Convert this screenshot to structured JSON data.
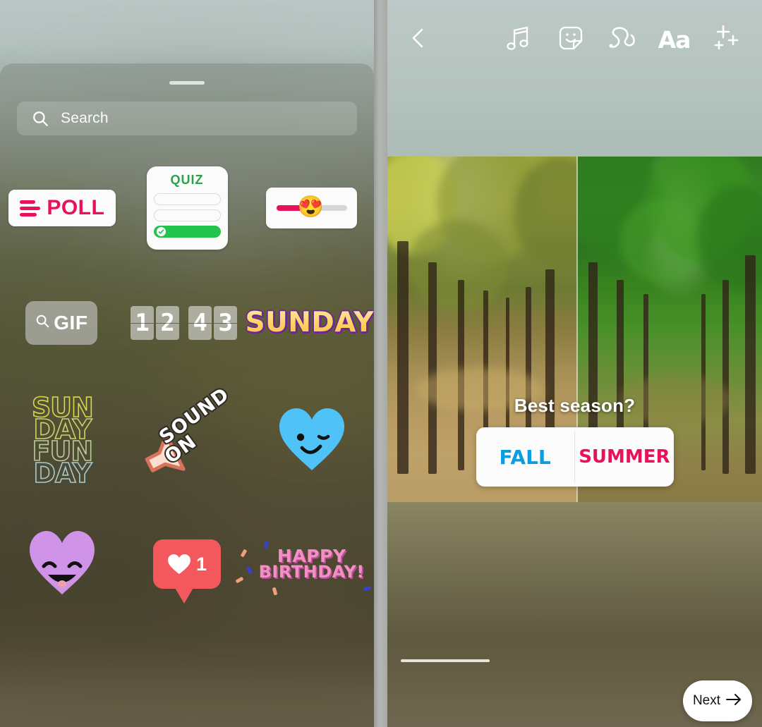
{
  "left_panel": {
    "name": "sticker-tray",
    "grabber": "drag-handle",
    "search": {
      "placeholder": "Search",
      "value": "",
      "icon": "search-icon"
    },
    "stickers": [
      [
        {
          "id": "poll",
          "type": "poll-sticker",
          "label": "POLL",
          "color": "#e8115b"
        },
        {
          "id": "quiz",
          "type": "quiz-sticker",
          "label": "QUIZ",
          "color": "#2aa14a",
          "options": [
            "",
            "",
            ""
          ],
          "correct_index": 2
        },
        {
          "id": "emoji-slider",
          "type": "emoji-slider-sticker",
          "emoji": "😍",
          "fill_color": "#e8115b",
          "fill_percent": 46
        }
      ],
      [
        {
          "id": "gif",
          "type": "gif-sticker",
          "label": "GIF",
          "icon": "search-icon"
        },
        {
          "id": "time",
          "type": "time-sticker",
          "digits": [
            "1",
            "2",
            "4",
            "3"
          ]
        },
        {
          "id": "sunday",
          "type": "text-sticker",
          "label": "SUNDAY",
          "color": "#ffcf5e",
          "outline_color": "#6c2a8e"
        }
      ],
      [
        {
          "id": "sunday-fun-day",
          "type": "outline-text-sticker",
          "lines": [
            "SUN",
            "DAY",
            "FUN",
            "DAY"
          ],
          "colors": [
            "#d8d84a",
            "#cfd066",
            "#b9cc9a",
            "#a9c9cf"
          ]
        },
        {
          "id": "sound-on",
          "type": "sound-on-sticker",
          "lines": [
            "SOUND",
            "ON"
          ]
        },
        {
          "id": "blue-wink-heart",
          "type": "emoji-heart-sticker",
          "color": "#4fc3f7",
          "expression": "wink"
        }
      ],
      [
        {
          "id": "purple-laugh-heart",
          "type": "emoji-heart-sticker",
          "color": "#cf93e8",
          "expression": "laugh"
        },
        {
          "id": "like-bubble",
          "type": "like-sticker",
          "count": "1",
          "color": "#f3585c"
        },
        {
          "id": "happy-birthday",
          "type": "text-sticker",
          "lines": [
            "HAPPY",
            "BIRTHDAY!"
          ],
          "color": "#f48fc4"
        }
      ]
    ]
  },
  "right_panel": {
    "name": "story-editor",
    "toolbar": {
      "back": "back-chevron-icon",
      "items": [
        {
          "id": "music",
          "icon": "music-note-icon",
          "label": "Music"
        },
        {
          "id": "sticker",
          "icon": "sticker-smiley-icon",
          "label": "Sticker"
        },
        {
          "id": "draw",
          "icon": "draw-squiggle-icon",
          "label": "Draw"
        },
        {
          "id": "text",
          "icon": "text-aa-icon",
          "label": "Aa"
        },
        {
          "id": "effects",
          "icon": "sparkles-icon",
          "label": "Effects"
        }
      ]
    },
    "poll_overlay": {
      "question": "Best season?",
      "option_a": "FALL",
      "option_a_color": "#0b9de0",
      "option_b": "SUMMER",
      "option_b_color": "#e8115b"
    },
    "next_button": {
      "label": "Next",
      "icon": "arrow-right-icon"
    }
  }
}
